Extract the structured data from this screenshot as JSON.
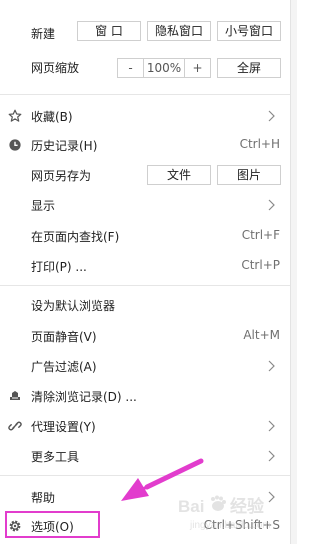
{
  "new_row": {
    "label": "新建",
    "window_btn": "窗 口",
    "private_btn": "隐私窗口",
    "small_btn": "小号窗口"
  },
  "zoom_row": {
    "label": "网页缩放",
    "minus": "-",
    "value": "100%",
    "plus": "+",
    "fullscreen": "全屏"
  },
  "items": {
    "favorites": "收藏(B)",
    "history": "历史记录(H)",
    "history_shortcut": "Ctrl+H",
    "save_as": "网页另存为",
    "save_file": "文件",
    "save_image": "图片",
    "display": "显示",
    "find": "在页面内查找(F)",
    "find_shortcut": "Ctrl+F",
    "print": "打印(P) ...",
    "print_shortcut": "Ctrl+P",
    "default_browser": "设为默认浏览器",
    "mute": "页面静音(V)",
    "mute_shortcut": "Alt+M",
    "adfilter": "广告过滤(A)",
    "clear": "清除浏览记录(D) ...",
    "proxy": "代理设置(Y)",
    "more_tools": "更多工具",
    "help": "帮助",
    "options": "选项(O)",
    "options_shortcut": "Ctrl+Shift+S"
  },
  "watermark": {
    "brand": "Bai",
    "brand2": "经验",
    "sub": "jingyan.baidu.com"
  },
  "colors": {
    "highlight": "#e23ccd",
    "separator": "#e6e6e6",
    "shortcut": "#707070"
  }
}
